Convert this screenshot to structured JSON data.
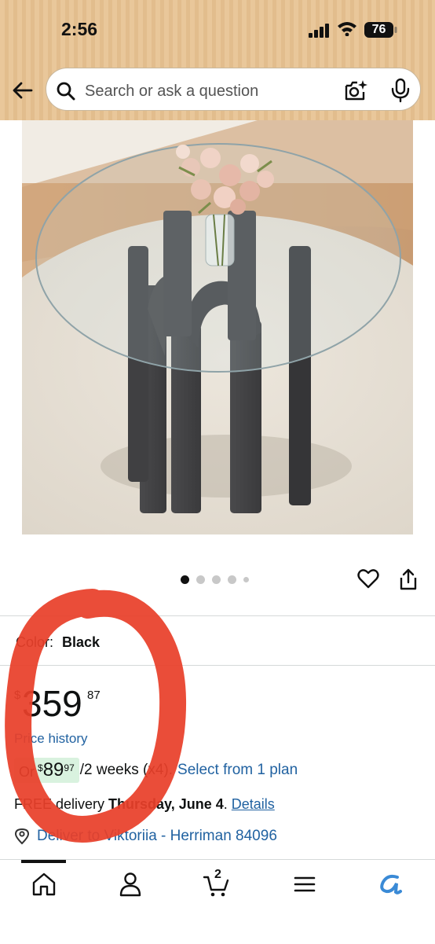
{
  "status_bar": {
    "time": "2:56",
    "battery": "76"
  },
  "search": {
    "placeholder": "Search or ask a question"
  },
  "gallery": {
    "image_count": 5,
    "active_index": 0
  },
  "product": {
    "color_label": "Color:",
    "color_value": "Black",
    "price_symbol": "$",
    "price_whole": "359",
    "price_fraction": "87",
    "price_history_label": "Price history",
    "installment": {
      "or_label": "Or",
      "symbol": "$",
      "amount_whole": "89",
      "amount_fraction": "97",
      "terms": "/2 weeks (x4).",
      "plan_link": "Select from 1 plan"
    },
    "delivery": {
      "prefix": "FREE delivery ",
      "date": "Thursday, June 4",
      "period": ". ",
      "details_link": "Details"
    },
    "deliver_to": "Deliver to Viktoriia - Herriman 84096"
  },
  "bottom_nav": {
    "cart_count": "2",
    "items": [
      "home-icon",
      "account-icon",
      "cart-icon",
      "menu-icon",
      "rufus-icon"
    ]
  },
  "colors": {
    "header_bg": "#e9c79a",
    "link": "#2162a1",
    "installment_highlight": "#d9f2df",
    "annotation_red": "#e8402a"
  }
}
